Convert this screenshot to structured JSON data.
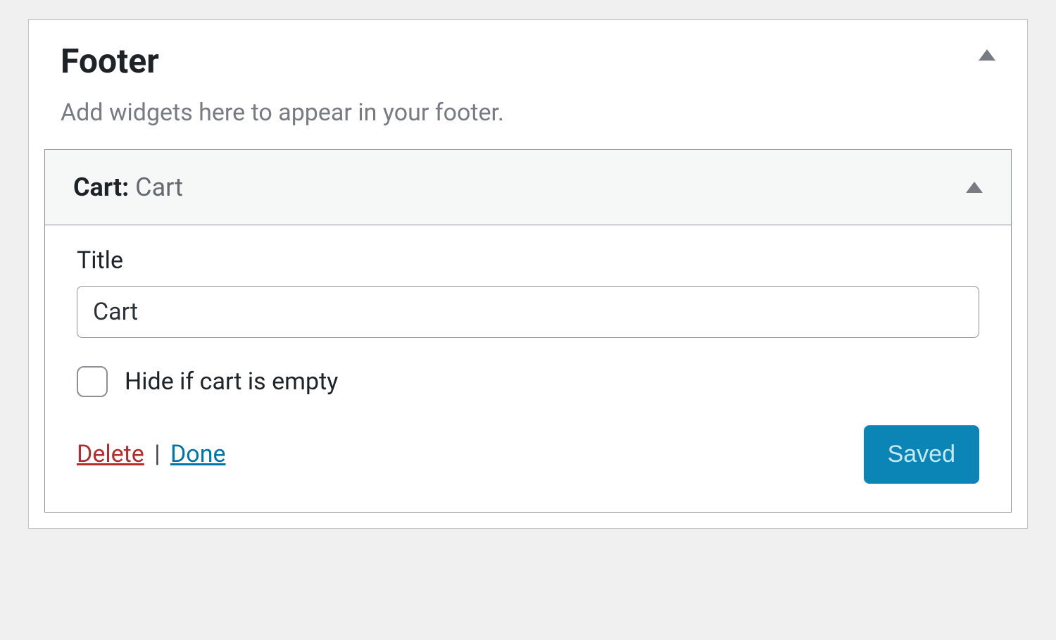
{
  "area": {
    "title": "Footer",
    "description": "Add widgets here to appear in your footer."
  },
  "widget": {
    "type_label": "Cart",
    "instance_label": "Cart",
    "fields": {
      "title_label": "Title",
      "title_value": "Cart",
      "hide_empty_label": "Hide if cart is empty",
      "hide_empty_checked": false
    },
    "actions": {
      "delete": "Delete",
      "separator": "|",
      "done": "Done",
      "saved": "Saved"
    }
  }
}
